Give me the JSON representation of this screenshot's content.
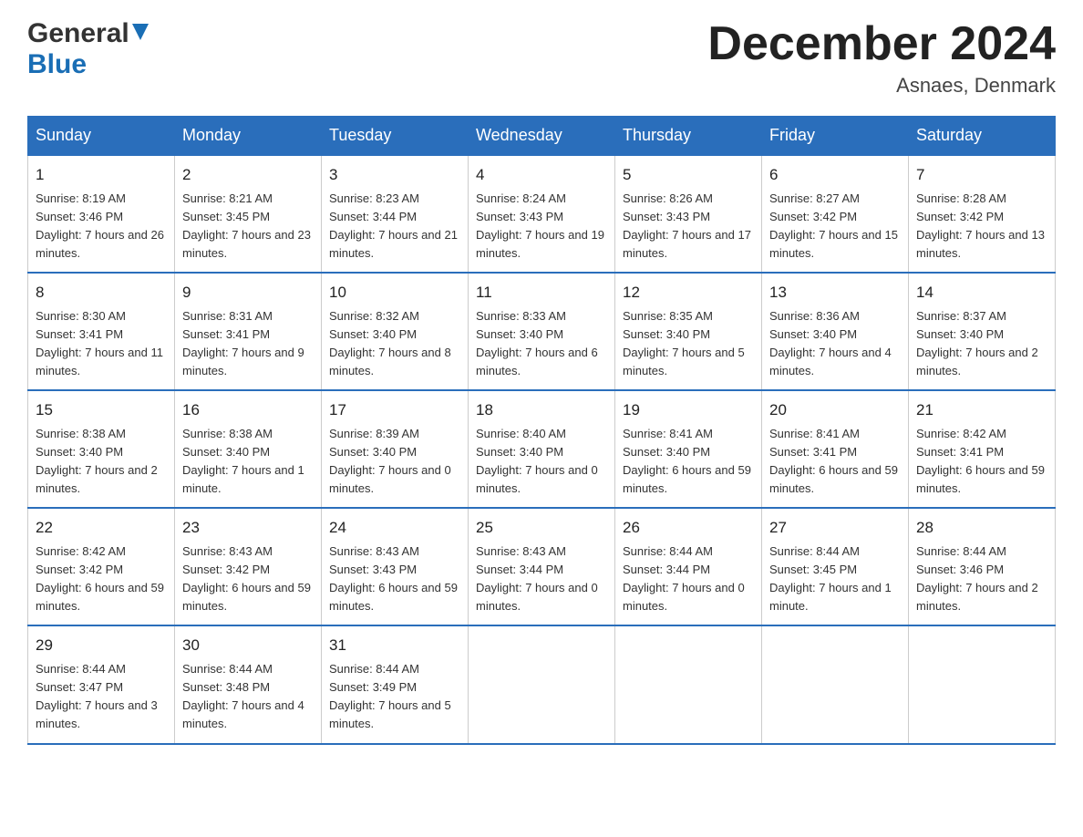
{
  "header": {
    "title": "December 2024",
    "location": "Asnaes, Denmark",
    "logo_general": "General",
    "logo_blue": "Blue"
  },
  "days_of_week": [
    "Sunday",
    "Monday",
    "Tuesday",
    "Wednesday",
    "Thursday",
    "Friday",
    "Saturday"
  ],
  "weeks": [
    [
      {
        "day": "1",
        "sunrise": "8:19 AM",
        "sunset": "3:46 PM",
        "daylight": "7 hours and 26 minutes."
      },
      {
        "day": "2",
        "sunrise": "8:21 AM",
        "sunset": "3:45 PM",
        "daylight": "7 hours and 23 minutes."
      },
      {
        "day": "3",
        "sunrise": "8:23 AM",
        "sunset": "3:44 PM",
        "daylight": "7 hours and 21 minutes."
      },
      {
        "day": "4",
        "sunrise": "8:24 AM",
        "sunset": "3:43 PM",
        "daylight": "7 hours and 19 minutes."
      },
      {
        "day": "5",
        "sunrise": "8:26 AM",
        "sunset": "3:43 PM",
        "daylight": "7 hours and 17 minutes."
      },
      {
        "day": "6",
        "sunrise": "8:27 AM",
        "sunset": "3:42 PM",
        "daylight": "7 hours and 15 minutes."
      },
      {
        "day": "7",
        "sunrise": "8:28 AM",
        "sunset": "3:42 PM",
        "daylight": "7 hours and 13 minutes."
      }
    ],
    [
      {
        "day": "8",
        "sunrise": "8:30 AM",
        "sunset": "3:41 PM",
        "daylight": "7 hours and 11 minutes."
      },
      {
        "day": "9",
        "sunrise": "8:31 AM",
        "sunset": "3:41 PM",
        "daylight": "7 hours and 9 minutes."
      },
      {
        "day": "10",
        "sunrise": "8:32 AM",
        "sunset": "3:40 PM",
        "daylight": "7 hours and 8 minutes."
      },
      {
        "day": "11",
        "sunrise": "8:33 AM",
        "sunset": "3:40 PM",
        "daylight": "7 hours and 6 minutes."
      },
      {
        "day": "12",
        "sunrise": "8:35 AM",
        "sunset": "3:40 PM",
        "daylight": "7 hours and 5 minutes."
      },
      {
        "day": "13",
        "sunrise": "8:36 AM",
        "sunset": "3:40 PM",
        "daylight": "7 hours and 4 minutes."
      },
      {
        "day": "14",
        "sunrise": "8:37 AM",
        "sunset": "3:40 PM",
        "daylight": "7 hours and 2 minutes."
      }
    ],
    [
      {
        "day": "15",
        "sunrise": "8:38 AM",
        "sunset": "3:40 PM",
        "daylight": "7 hours and 2 minutes."
      },
      {
        "day": "16",
        "sunrise": "8:38 AM",
        "sunset": "3:40 PM",
        "daylight": "7 hours and 1 minute."
      },
      {
        "day": "17",
        "sunrise": "8:39 AM",
        "sunset": "3:40 PM",
        "daylight": "7 hours and 0 minutes."
      },
      {
        "day": "18",
        "sunrise": "8:40 AM",
        "sunset": "3:40 PM",
        "daylight": "7 hours and 0 minutes."
      },
      {
        "day": "19",
        "sunrise": "8:41 AM",
        "sunset": "3:40 PM",
        "daylight": "6 hours and 59 minutes."
      },
      {
        "day": "20",
        "sunrise": "8:41 AM",
        "sunset": "3:41 PM",
        "daylight": "6 hours and 59 minutes."
      },
      {
        "day": "21",
        "sunrise": "8:42 AM",
        "sunset": "3:41 PM",
        "daylight": "6 hours and 59 minutes."
      }
    ],
    [
      {
        "day": "22",
        "sunrise": "8:42 AM",
        "sunset": "3:42 PM",
        "daylight": "6 hours and 59 minutes."
      },
      {
        "day": "23",
        "sunrise": "8:43 AM",
        "sunset": "3:42 PM",
        "daylight": "6 hours and 59 minutes."
      },
      {
        "day": "24",
        "sunrise": "8:43 AM",
        "sunset": "3:43 PM",
        "daylight": "6 hours and 59 minutes."
      },
      {
        "day": "25",
        "sunrise": "8:43 AM",
        "sunset": "3:44 PM",
        "daylight": "7 hours and 0 minutes."
      },
      {
        "day": "26",
        "sunrise": "8:44 AM",
        "sunset": "3:44 PM",
        "daylight": "7 hours and 0 minutes."
      },
      {
        "day": "27",
        "sunrise": "8:44 AM",
        "sunset": "3:45 PM",
        "daylight": "7 hours and 1 minute."
      },
      {
        "day": "28",
        "sunrise": "8:44 AM",
        "sunset": "3:46 PM",
        "daylight": "7 hours and 2 minutes."
      }
    ],
    [
      {
        "day": "29",
        "sunrise": "8:44 AM",
        "sunset": "3:47 PM",
        "daylight": "7 hours and 3 minutes."
      },
      {
        "day": "30",
        "sunrise": "8:44 AM",
        "sunset": "3:48 PM",
        "daylight": "7 hours and 4 minutes."
      },
      {
        "day": "31",
        "sunrise": "8:44 AM",
        "sunset": "3:49 PM",
        "daylight": "7 hours and 5 minutes."
      },
      null,
      null,
      null,
      null
    ]
  ],
  "labels": {
    "sunrise": "Sunrise:",
    "sunset": "Sunset:",
    "daylight": "Daylight:"
  },
  "colors": {
    "header_bg": "#2a6ebb",
    "border": "#2a6ebb"
  }
}
